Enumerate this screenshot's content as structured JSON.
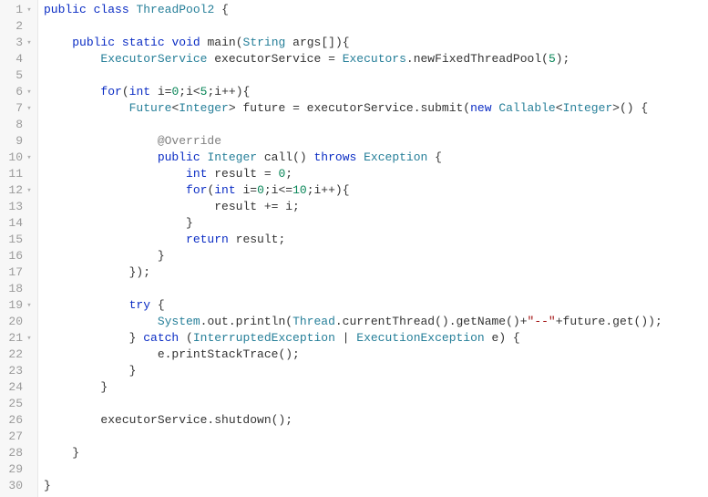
{
  "gutter": {
    "rows": [
      {
        "n": "1",
        "f": "▾"
      },
      {
        "n": "2",
        "f": ""
      },
      {
        "n": "3",
        "f": "▾"
      },
      {
        "n": "4",
        "f": ""
      },
      {
        "n": "5",
        "f": ""
      },
      {
        "n": "6",
        "f": "▾"
      },
      {
        "n": "7",
        "f": "▾"
      },
      {
        "n": "8",
        "f": ""
      },
      {
        "n": "9",
        "f": ""
      },
      {
        "n": "10",
        "f": "▾"
      },
      {
        "n": "11",
        "f": ""
      },
      {
        "n": "12",
        "f": "▾"
      },
      {
        "n": "13",
        "f": ""
      },
      {
        "n": "14",
        "f": ""
      },
      {
        "n": "15",
        "f": ""
      },
      {
        "n": "16",
        "f": ""
      },
      {
        "n": "17",
        "f": ""
      },
      {
        "n": "18",
        "f": ""
      },
      {
        "n": "19",
        "f": "▾"
      },
      {
        "n": "20",
        "f": ""
      },
      {
        "n": "21",
        "f": "▾"
      },
      {
        "n": "22",
        "f": ""
      },
      {
        "n": "23",
        "f": ""
      },
      {
        "n": "24",
        "f": ""
      },
      {
        "n": "25",
        "f": ""
      },
      {
        "n": "26",
        "f": ""
      },
      {
        "n": "27",
        "f": ""
      },
      {
        "n": "28",
        "f": ""
      },
      {
        "n": "29",
        "f": ""
      },
      {
        "n": "30",
        "f": ""
      }
    ]
  },
  "code": {
    "lines": [
      [
        [
          "kw",
          "public"
        ],
        [
          "pn",
          " "
        ],
        [
          "kw",
          "class"
        ],
        [
          "pn",
          " "
        ],
        [
          "type",
          "ThreadPool2"
        ],
        [
          "pn",
          " {"
        ]
      ],
      [],
      [
        [
          "pn",
          "    "
        ],
        [
          "kw",
          "public"
        ],
        [
          "pn",
          " "
        ],
        [
          "kw",
          "static"
        ],
        [
          "pn",
          " "
        ],
        [
          "kw",
          "void"
        ],
        [
          "pn",
          " "
        ],
        [
          "id",
          "main"
        ],
        [
          "pn",
          "("
        ],
        [
          "type",
          "String"
        ],
        [
          "pn",
          " args[]){"
        ]
      ],
      [
        [
          "pn",
          "        "
        ],
        [
          "type",
          "ExecutorService"
        ],
        [
          "pn",
          " executorService = "
        ],
        [
          "type",
          "Executors"
        ],
        [
          "pn",
          ".newFixedThreadPool("
        ],
        [
          "num-lit",
          "5"
        ],
        [
          "pn",
          ");"
        ]
      ],
      [],
      [
        [
          "pn",
          "        "
        ],
        [
          "kw",
          "for"
        ],
        [
          "pn",
          "("
        ],
        [
          "kw",
          "int"
        ],
        [
          "pn",
          " i="
        ],
        [
          "num-lit",
          "0"
        ],
        [
          "pn",
          ";i<"
        ],
        [
          "num-lit",
          "5"
        ],
        [
          "pn",
          ";i++){"
        ]
      ],
      [
        [
          "pn",
          "            "
        ],
        [
          "type",
          "Future"
        ],
        [
          "pn",
          "<"
        ],
        [
          "type",
          "Integer"
        ],
        [
          "pn",
          "> future = executorService.submit("
        ],
        [
          "kw",
          "new"
        ],
        [
          "pn",
          " "
        ],
        [
          "type",
          "Callable"
        ],
        [
          "pn",
          "<"
        ],
        [
          "type",
          "Integer"
        ],
        [
          "pn",
          ">() {"
        ]
      ],
      [],
      [
        [
          "pn",
          "                "
        ],
        [
          "ann",
          "@Override"
        ]
      ],
      [
        [
          "pn",
          "                "
        ],
        [
          "kw",
          "public"
        ],
        [
          "pn",
          " "
        ],
        [
          "type",
          "Integer"
        ],
        [
          "pn",
          " "
        ],
        [
          "id",
          "call"
        ],
        [
          "pn",
          "() "
        ],
        [
          "kw",
          "throws"
        ],
        [
          "pn",
          " "
        ],
        [
          "type",
          "Exception"
        ],
        [
          "pn",
          " {"
        ]
      ],
      [
        [
          "pn",
          "                    "
        ],
        [
          "kw",
          "int"
        ],
        [
          "pn",
          " result = "
        ],
        [
          "num-lit",
          "0"
        ],
        [
          "pn",
          ";"
        ]
      ],
      [
        [
          "pn",
          "                    "
        ],
        [
          "kw",
          "for"
        ],
        [
          "pn",
          "("
        ],
        [
          "kw",
          "int"
        ],
        [
          "pn",
          " i="
        ],
        [
          "num-lit",
          "0"
        ],
        [
          "pn",
          ";i<="
        ],
        [
          "num-lit",
          "10"
        ],
        [
          "pn",
          ";i++){"
        ]
      ],
      [
        [
          "pn",
          "                        result += i;"
        ]
      ],
      [
        [
          "pn",
          "                    }"
        ]
      ],
      [
        [
          "pn",
          "                    "
        ],
        [
          "kw",
          "return"
        ],
        [
          "pn",
          " result;"
        ]
      ],
      [
        [
          "pn",
          "                }"
        ]
      ],
      [
        [
          "pn",
          "            });"
        ]
      ],
      [],
      [
        [
          "pn",
          "            "
        ],
        [
          "kw",
          "try"
        ],
        [
          "pn",
          " {"
        ]
      ],
      [
        [
          "pn",
          "                "
        ],
        [
          "type",
          "System"
        ],
        [
          "pn",
          ".out.println("
        ],
        [
          "type",
          "Thread"
        ],
        [
          "pn",
          ".currentThread().getName()+"
        ],
        [
          "str",
          "\"--\""
        ],
        [
          "pn",
          "+future.get());"
        ]
      ],
      [
        [
          "pn",
          "            } "
        ],
        [
          "kw",
          "catch"
        ],
        [
          "pn",
          " ("
        ],
        [
          "type",
          "InterruptedException"
        ],
        [
          "pn",
          " | "
        ],
        [
          "type",
          "ExecutionException"
        ],
        [
          "pn",
          " e) {"
        ]
      ],
      [
        [
          "pn",
          "                e.printStackTrace();"
        ]
      ],
      [
        [
          "pn",
          "            }"
        ]
      ],
      [
        [
          "pn",
          "        }"
        ]
      ],
      [],
      [
        [
          "pn",
          "        executorService.shutdown();"
        ]
      ],
      [],
      [
        [
          "pn",
          "    }"
        ]
      ],
      [],
      [
        [
          "pn",
          "}"
        ]
      ]
    ]
  }
}
